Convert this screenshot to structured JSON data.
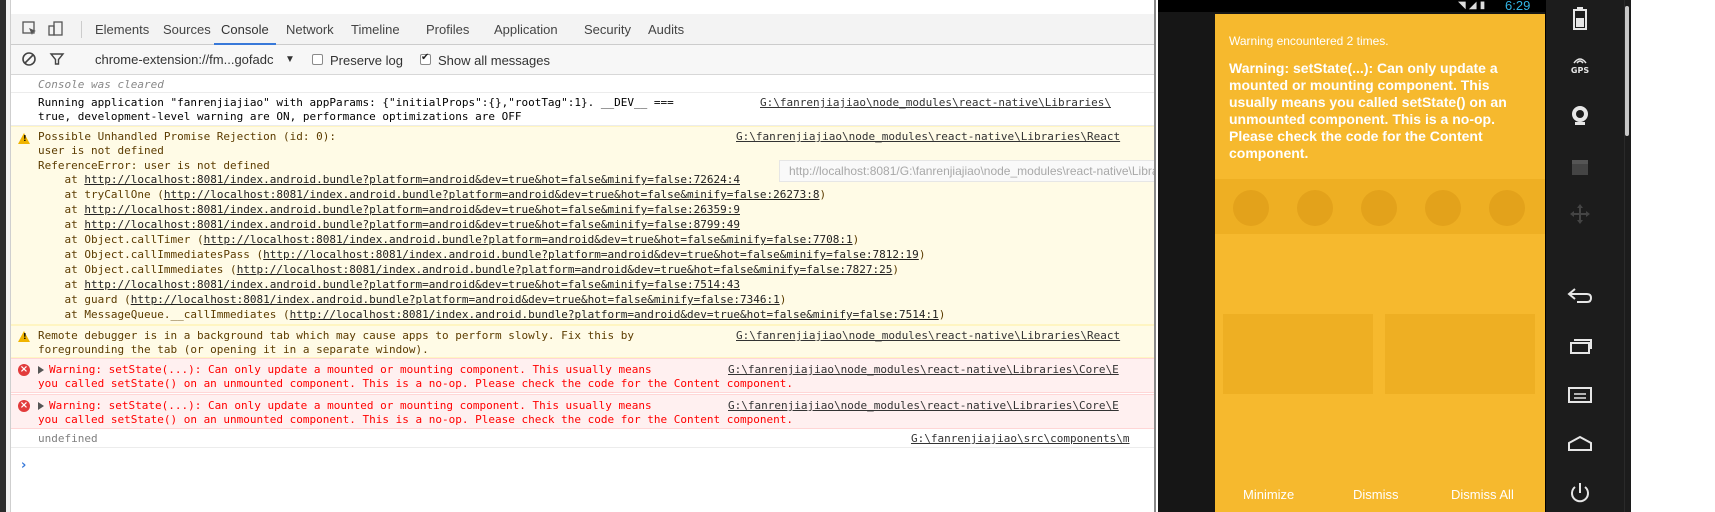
{
  "devtools": {
    "tabs": [
      "Elements",
      "Sources",
      "Console",
      "Network",
      "Timeline",
      "Profiles",
      "Application",
      "Security",
      "Audits"
    ],
    "active_tab": "Console",
    "filter": {
      "context": "chrome-extension://fm...gofadc",
      "preserve_log_label": "Preserve log",
      "preserve_log_checked": false,
      "show_all_label": "Show all messages",
      "show_all_checked": true
    },
    "console": {
      "cleared": "Console was cleared",
      "running_1": "Running application \"fanrenjiajiao\" with appParams: {\"initialProps\":{},\"rootTag\":1}. __DEV__ ===",
      "running_2": "true, development-level warning are ON, performance optimizations are OFF",
      "running_src": "G:\\fanrenjiajiao\\node_modules\\react-native\\Libraries\\",
      "promise_1": "Possible Unhandled Promise Rejection (id: 0):",
      "promise_2": "user is not defined",
      "promise_3": "ReferenceError: user is not defined",
      "promise_src": "G:\\fanrenjiajiao\\node_modules\\react-native\\Libraries\\React",
      "tooltip": "http://localhost:8081/G:\\fanrenjiajiao\\node_modules\\react-native\\Libra",
      "stack": [
        {
          "pre": "    at ",
          "link": "http://localhost:8081/index.android.bundle?platform=android&dev=true&hot=false&minify=false:72624:4",
          "post": ""
        },
        {
          "pre": "    at tryCallOne (",
          "link": "http://localhost:8081/index.android.bundle?platform=android&dev=true&hot=false&minify=false:26273:8",
          "post": ")"
        },
        {
          "pre": "    at ",
          "link": "http://localhost:8081/index.android.bundle?platform=android&dev=true&hot=false&minify=false:26359:9",
          "post": ""
        },
        {
          "pre": "    at ",
          "link": "http://localhost:8081/index.android.bundle?platform=android&dev=true&hot=false&minify=false:8799:49",
          "post": ""
        },
        {
          "pre": "    at Object.callTimer (",
          "link": "http://localhost:8081/index.android.bundle?platform=android&dev=true&hot=false&minify=false:7708:1",
          "post": ")"
        },
        {
          "pre": "    at Object.callImmediatesPass (",
          "link": "http://localhost:8081/index.android.bundle?platform=android&dev=true&hot=false&minify=false:7812:19",
          "post": ")"
        },
        {
          "pre": "    at Object.callImmediates (",
          "link": "http://localhost:8081/index.android.bundle?platform=android&dev=true&hot=false&minify=false:7827:25",
          "post": ")"
        },
        {
          "pre": "    at ",
          "link": "http://localhost:8081/index.android.bundle?platform=android&dev=true&hot=false&minify=false:7514:43",
          "post": ""
        },
        {
          "pre": "    at guard (",
          "link": "http://localhost:8081/index.android.bundle?platform=android&dev=true&hot=false&minify=false:7346:1",
          "post": ")"
        },
        {
          "pre": "    at MessageQueue.__callImmediates (",
          "link": "http://localhost:8081/index.android.bundle?platform=android&dev=true&hot=false&minify=false:7514:1",
          "post": ")"
        }
      ],
      "debugger_1": "Remote debugger is in a background tab which may cause apps to perform slowly. Fix this by",
      "debugger_2": "foregrounding the tab (or opening it in a separate window).",
      "debugger_src": "G:\\fanrenjiajiao\\node_modules\\react-native\\Libraries\\React",
      "error_1": "Warning: setState(...): Can only update a mounted or mounting component. This usually means",
      "error_2": "you called setState() on an unmounted component. This is a no-op. Please check the code for the Content component.",
      "error_src": "G:\\fanrenjiajiao\\node_modules\\react-native\\Libraries\\Core\\E",
      "undefined": "undefined",
      "undefined_src": "G:\\fanrenjiajiao\\src\\components\\m"
    }
  },
  "emulator": {
    "time": "6:29",
    "toast_count": "Warning encountered 2 times.",
    "toast_message": "Warning: setState(...): Can only update a mounted or mounting component. This usually means you called setState() on an unmounted component. This is a no-op. Please check the code for the Content component.",
    "buttons": [
      "Minimize",
      "Dismiss",
      "Dismiss All"
    ],
    "side_buttons": {
      "gps_label": "GPS"
    }
  },
  "colors": {
    "active_tab_underline": "#3879d9",
    "warning_bg": "#fffbe6",
    "error_text": "#ff0000",
    "toast_bg": "#f6b92e",
    "clock": "#33b5e5"
  }
}
